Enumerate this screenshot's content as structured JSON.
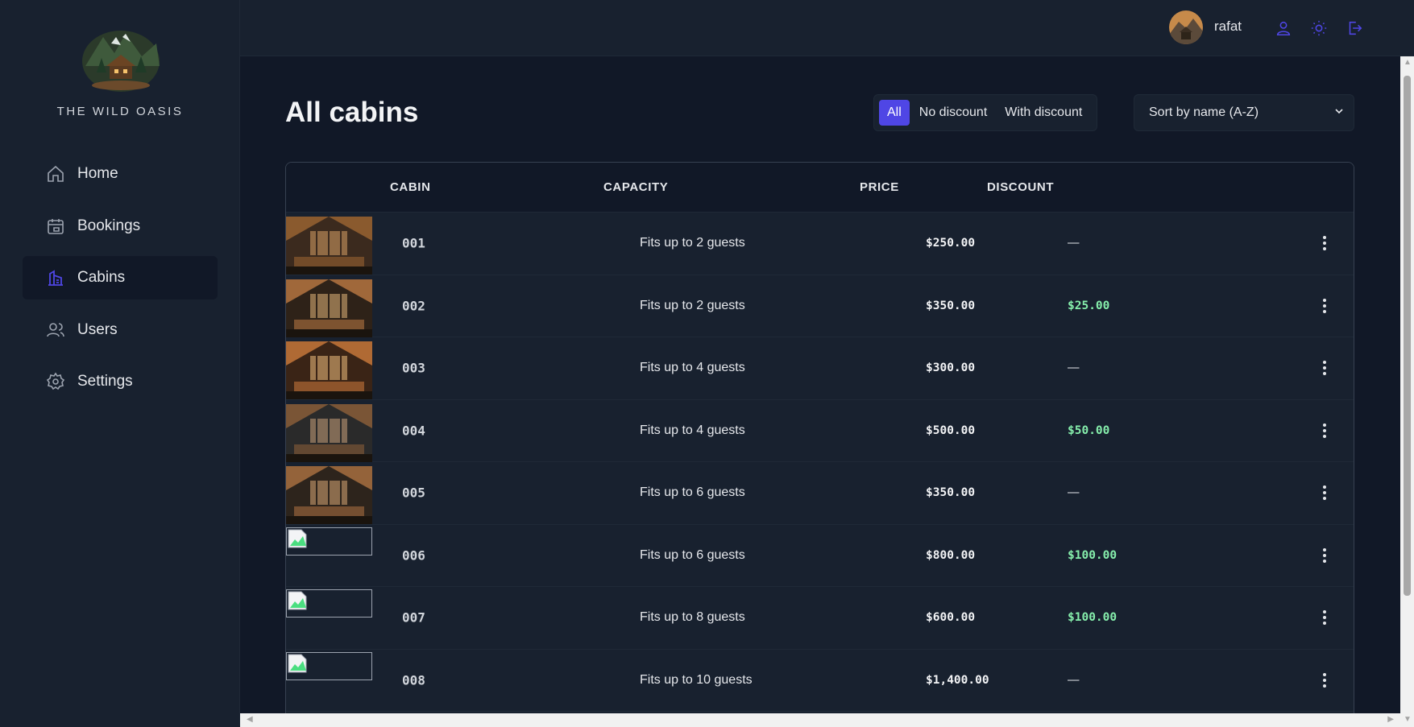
{
  "brand": {
    "name": "THE WILD OASIS"
  },
  "sidebar": {
    "items": [
      {
        "label": "Home",
        "icon": "home-icon",
        "active": false
      },
      {
        "label": "Bookings",
        "icon": "calendar-icon",
        "active": false
      },
      {
        "label": "Cabins",
        "icon": "cabins-icon",
        "active": true
      },
      {
        "label": "Users",
        "icon": "users-icon",
        "active": false
      },
      {
        "label": "Settings",
        "icon": "gear-icon",
        "active": false
      }
    ]
  },
  "header": {
    "username": "rafat",
    "icons": [
      "user-icon",
      "sun-icon",
      "logout-icon"
    ]
  },
  "main": {
    "title": "All cabins",
    "filter": {
      "options": [
        "All",
        "No discount",
        "With discount"
      ],
      "selected": "All"
    },
    "sort": {
      "selected": "Sort by name (A-Z)"
    }
  },
  "table": {
    "headers": [
      "",
      "CABIN",
      "CAPACITY",
      "PRICE",
      "DISCOUNT",
      ""
    ],
    "rows": [
      {
        "code": "001",
        "capacity": "Fits up to 2 guests",
        "price": "$250.00",
        "discount": "—",
        "image": "cabin-photo"
      },
      {
        "code": "002",
        "capacity": "Fits up to 2 guests",
        "price": "$350.00",
        "discount": "$25.00",
        "image": "cabin-photo"
      },
      {
        "code": "003",
        "capacity": "Fits up to 4 guests",
        "price": "$300.00",
        "discount": "—",
        "image": "cabin-photo"
      },
      {
        "code": "004",
        "capacity": "Fits up to 4 guests",
        "price": "$500.00",
        "discount": "$50.00",
        "image": "cabin-photo"
      },
      {
        "code": "005",
        "capacity": "Fits up to 6 guests",
        "price": "$350.00",
        "discount": "—",
        "image": "cabin-photo"
      },
      {
        "code": "006",
        "capacity": "Fits up to 6 guests",
        "price": "$800.00",
        "discount": "$100.00",
        "image": "broken-image"
      },
      {
        "code": "007",
        "capacity": "Fits up to 8 guests",
        "price": "$600.00",
        "discount": "$100.00",
        "image": "broken-image"
      },
      {
        "code": "008",
        "capacity": "Fits up to 10 guests",
        "price": "$1,400.00",
        "discount": "—",
        "image": "broken-image"
      }
    ]
  },
  "colors": {
    "accent": "#4f46e5",
    "discount": "#86efac",
    "sidebar_bg": "#18212f",
    "main_bg": "#111827"
  }
}
